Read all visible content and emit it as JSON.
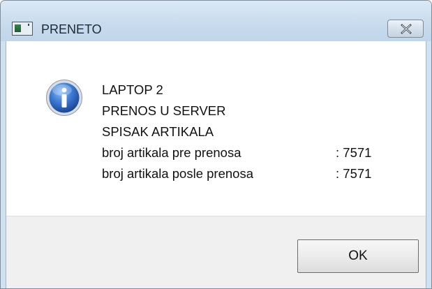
{
  "window": {
    "title": "PRENETO",
    "app_icon": "program-window-icon",
    "close_icon": "close-x-icon"
  },
  "dialog": {
    "icon": "information-icon",
    "lines": [
      "LAPTOP 2",
      "PRENOS U SERVER",
      "SPISAK ARTIKALA"
    ],
    "counts": [
      {
        "label": "broj artikala pre prenosa",
        "value": ": 7571"
      },
      {
        "label": "broj artikala posle prenosa",
        "value": ": 7571"
      }
    ],
    "ok_label": "OK"
  },
  "colors": {
    "titlebar": "#c9dcee",
    "info_icon_blue": "#2f6fcf",
    "button_area": "#f0f0f0"
  }
}
